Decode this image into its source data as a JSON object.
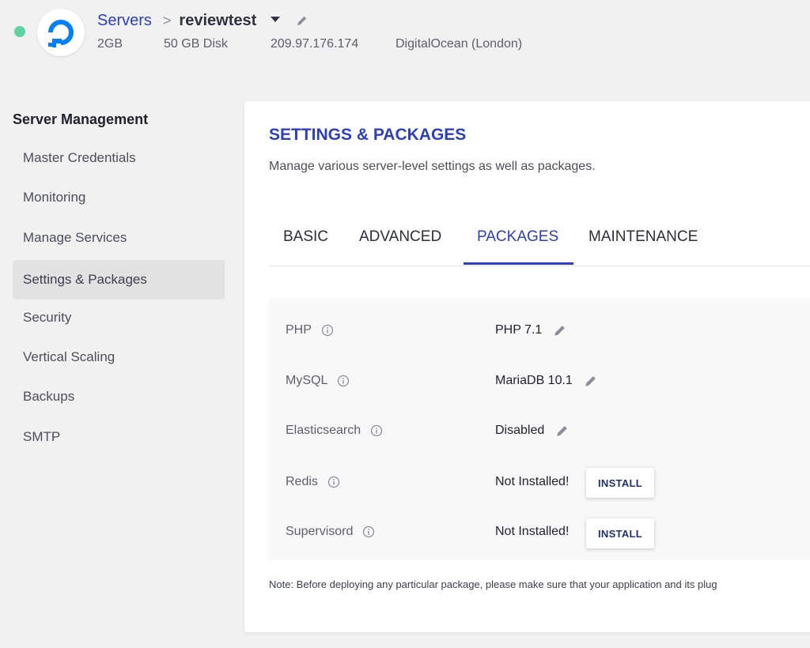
{
  "header": {
    "status_color": "#5fd39d",
    "logo_icon": "digitalocean-logo",
    "breadcrumb_parent": "Servers",
    "breadcrumb_sep": ">",
    "server_name": "reviewtest",
    "ram": "2GB",
    "disk": "50 GB Disk",
    "ip": "209.97.176.174",
    "provider": "DigitalOcean (London)"
  },
  "sidebar": {
    "title": "Server Management",
    "items": [
      {
        "label": "Master Credentials"
      },
      {
        "label": "Monitoring"
      },
      {
        "label": "Manage Services"
      },
      {
        "label": "Settings & Packages",
        "active": true
      },
      {
        "label": "Security"
      },
      {
        "label": "Vertical Scaling"
      },
      {
        "label": "Backups"
      },
      {
        "label": "SMTP"
      }
    ]
  },
  "main": {
    "title": "SETTINGS & PACKAGES",
    "subtitle": "Manage various server-level settings as well as packages.",
    "tabs": [
      {
        "label": "BASIC"
      },
      {
        "label": "ADVANCED"
      },
      {
        "label": "PACKAGES",
        "active": true
      },
      {
        "label": "MAINTENANCE"
      }
    ],
    "packages": [
      {
        "name": "PHP",
        "value": "PHP 7.1",
        "action": "edit"
      },
      {
        "name": "MySQL",
        "value": "MariaDB 10.1",
        "action": "edit"
      },
      {
        "name": "Elasticsearch",
        "value": "Disabled",
        "action": "edit"
      },
      {
        "name": "Redis",
        "value": "Not Installed!",
        "action": "install",
        "button_label": "INSTALL"
      },
      {
        "name": "Supervisord",
        "value": "Not Installed!",
        "action": "install",
        "button_label": "INSTALL"
      }
    ],
    "note": "Note: Before deploying any particular package, please make sure that your application and its plug"
  },
  "colors": {
    "accent": "#2e3ec1",
    "background": "#f1f1f1",
    "active_nav": "#e2e2e2"
  }
}
